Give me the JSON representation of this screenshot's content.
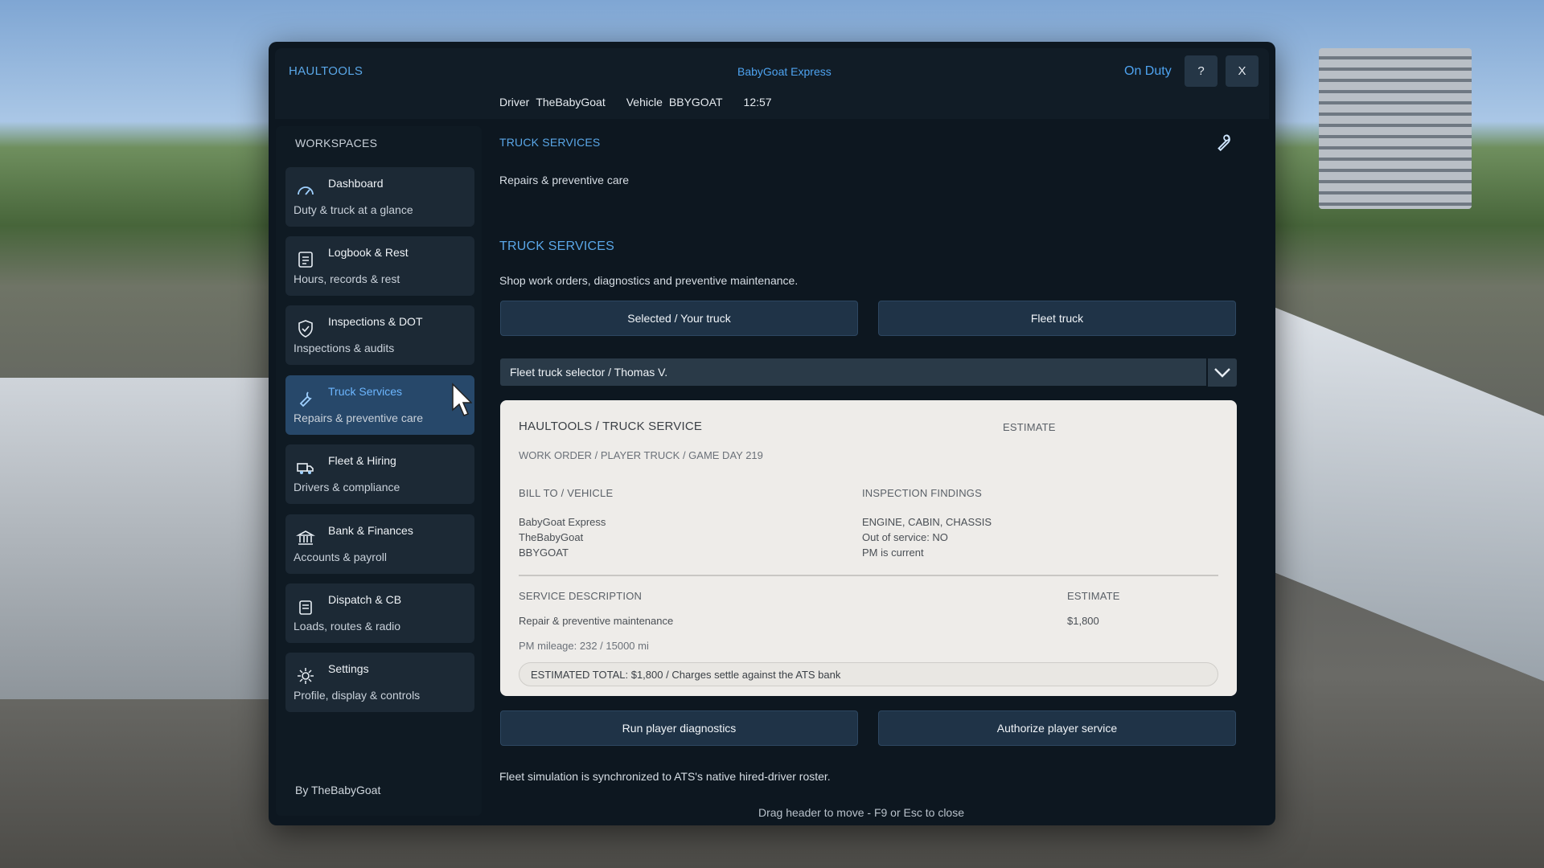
{
  "header": {
    "brand": "HAULTOOLS",
    "company": "BabyGoat Express",
    "status": "On Duty",
    "help_label": "?",
    "close_label": "X",
    "driver_label": "Driver",
    "driver": "TheBabyGoat",
    "vehicle_label": "Vehicle",
    "vehicle": "BBYGOAT",
    "time": "12:57"
  },
  "sidebar": {
    "title": "WORKSPACES",
    "items": [
      {
        "title": "Dashboard",
        "subtitle": "Duty & truck at a glance",
        "icon": "gauge-icon"
      },
      {
        "title": "Logbook & Rest",
        "subtitle": "Hours, records & rest",
        "icon": "logbook-icon"
      },
      {
        "title": "Inspections & DOT",
        "subtitle": "Inspections & audits",
        "icon": "shield-icon"
      },
      {
        "title": "Truck Services",
        "subtitle": "Repairs & preventive care",
        "icon": "wrench-icon",
        "active": true
      },
      {
        "title": "Fleet & Hiring",
        "subtitle": "Drivers & compliance",
        "icon": "truck-icon"
      },
      {
        "title": "Bank & Finances",
        "subtitle": "Accounts & payroll",
        "icon": "bank-icon"
      },
      {
        "title": "Dispatch & CB",
        "subtitle": "Loads, routes & radio",
        "icon": "radio-icon"
      },
      {
        "title": "Settings",
        "subtitle": "Profile, display & controls",
        "icon": "gear-icon"
      }
    ],
    "by": "By TheBabyGoat"
  },
  "main": {
    "section_small": "TRUCK SERVICES",
    "section_small_sub": "Repairs & preventive care",
    "section_title": "TRUCK SERVICES",
    "section_desc": "Shop work orders, diagnostics and preventive maintenance.",
    "btn_selected": "Selected / Your truck",
    "btn_fleet": "Fleet truck",
    "fleet_selector": "Fleet truck selector / Thomas V.",
    "btn_diagnostics": "Run player diagnostics",
    "btn_authorize": "Authorize player service",
    "note": "Fleet simulation is synchronized to ATS's native hired-driver roster.",
    "footer": "Drag header to move - F9 or Esc to close"
  },
  "card": {
    "title": "HAULTOOLS / TRUCK SERVICE",
    "badge": "ESTIMATE",
    "work_order": "WORK ORDER / PLAYER TRUCK / GAME DAY 219",
    "bill_to_label": "BILL TO / VEHICLE",
    "bill_to": [
      "BabyGoat Express",
      "TheBabyGoat",
      "BBYGOAT"
    ],
    "findings_label": "INSPECTION FINDINGS",
    "findings": [
      "ENGINE, CABIN, CHASSIS",
      "Out of service: NO",
      "PM is current"
    ],
    "service_label": "SERVICE DESCRIPTION",
    "estimate_label": "ESTIMATE",
    "service_desc": "Repair & preventive maintenance",
    "service_amount": "$1,800",
    "pm_mileage": "PM mileage: 232 / 15000 mi",
    "total": "ESTIMATED TOTAL: $1,800 / Charges settle against the ATS bank"
  }
}
